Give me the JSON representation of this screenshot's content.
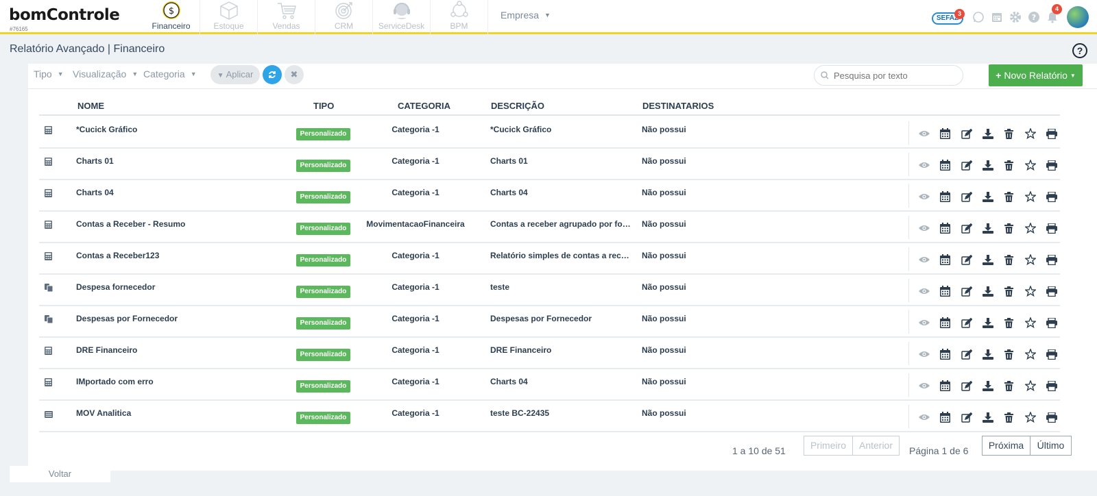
{
  "app": {
    "brand": "bomControle",
    "account_code": "#76165"
  },
  "modules": [
    {
      "label": "Financeiro",
      "icon": "dollar-coin-icon",
      "active": true
    },
    {
      "label": "Estoque",
      "icon": "box-icon",
      "active": false
    },
    {
      "label": "Vendas",
      "icon": "cart-icon",
      "active": false
    },
    {
      "label": "CRM",
      "icon": "target-icon",
      "active": false
    },
    {
      "label": "ServiceDesk",
      "icon": "headset-icon",
      "active": false
    },
    {
      "label": "BPM",
      "icon": "network-icon",
      "active": false
    }
  ],
  "empresa": {
    "label": "Empresa"
  },
  "top_right": {
    "sefaz_label": "SEFAZ",
    "sefaz_badge": "3",
    "notifications_badge": "4"
  },
  "page": {
    "title": "Relatório Avançado | Financeiro"
  },
  "filters": {
    "tipo": "Tipo",
    "visualizacao": "Visualização",
    "categoria": "Categoria",
    "apply_label": "Aplicar",
    "search_placeholder": "Pesquisa por texto",
    "new_report_label": "Novo Relatório"
  },
  "table": {
    "headers": {
      "nome": "NOME",
      "tipo": "TIPO",
      "categoria": "CATEGORIA",
      "descricao": "DESCRIÇÃO",
      "destinatarios": "DESTINATARIOS"
    },
    "rows": [
      {
        "icon": "calculator-icon",
        "nome": "*Cucick Gráfico",
        "tipo": "Personalizado",
        "categoria": "Categoria -1",
        "descricao": "*Cucick Gráfico",
        "destinatarios": "Não possui"
      },
      {
        "icon": "calculator-icon",
        "nome": "Charts 01",
        "tipo": "Personalizado",
        "categoria": "Categoria -1",
        "descricao": "Charts 01",
        "destinatarios": "Não possui"
      },
      {
        "icon": "calculator-icon",
        "nome": "Charts 04",
        "tipo": "Personalizado",
        "categoria": "Categoria -1",
        "descricao": "Charts 04",
        "destinatarios": "Não possui"
      },
      {
        "icon": "calculator-icon",
        "nome": "Contas a Receber - Resumo",
        "tipo": "Personalizado",
        "categoria": "MovimentacaoFinanceira",
        "descricao": "Contas a receber agrupado por for...",
        "destinatarios": "Não possui"
      },
      {
        "icon": "calculator-icon",
        "nome": "Contas a Receber123",
        "tipo": "Personalizado",
        "categoria": "Categoria -1",
        "descricao": "Relatório simples de contas a rece...",
        "destinatarios": "Não possui"
      },
      {
        "icon": "copy-icon",
        "nome": "Despesa fornecedor",
        "tipo": "Personalizado",
        "categoria": "Categoria -1",
        "descricao": "teste",
        "destinatarios": "Não possui"
      },
      {
        "icon": "copy-icon",
        "nome": "Despesas por Fornecedor",
        "tipo": "Personalizado",
        "categoria": "Categoria -1",
        "descricao": "Despesas por Fornecedor",
        "destinatarios": "Não possui"
      },
      {
        "icon": "calculator-icon",
        "nome": "DRE Financeiro",
        "tipo": "Personalizado",
        "categoria": "Categoria -1",
        "descricao": "DRE Financeiro",
        "destinatarios": "Não possui"
      },
      {
        "icon": "calculator-icon",
        "nome": "IMportado com erro",
        "tipo": "Personalizado",
        "categoria": "Categoria -1",
        "descricao": "Charts 04",
        "destinatarios": "Não possui"
      },
      {
        "icon": "list-icon",
        "nome": "MOV Analitica",
        "tipo": "Personalizado",
        "categoria": "Categoria -1",
        "descricao": "teste BC-22435",
        "destinatarios": "Não possui"
      }
    ]
  },
  "pagination": {
    "range": "1 a 10 de 51",
    "first": "Primeiro",
    "previous": "Anterior",
    "page_info": "Página 1 de 6",
    "next": "Próxima",
    "last": "Último"
  },
  "footer": {
    "back_label": "Voltar"
  },
  "colors": {
    "accent_yellow": "#f3d321",
    "primary_blue": "#2fa4e7",
    "success_green": "#4cae4c",
    "tag_green": "#5cb85c",
    "badge_red": "#e74c3c",
    "text_dark": "#2c3e50"
  }
}
